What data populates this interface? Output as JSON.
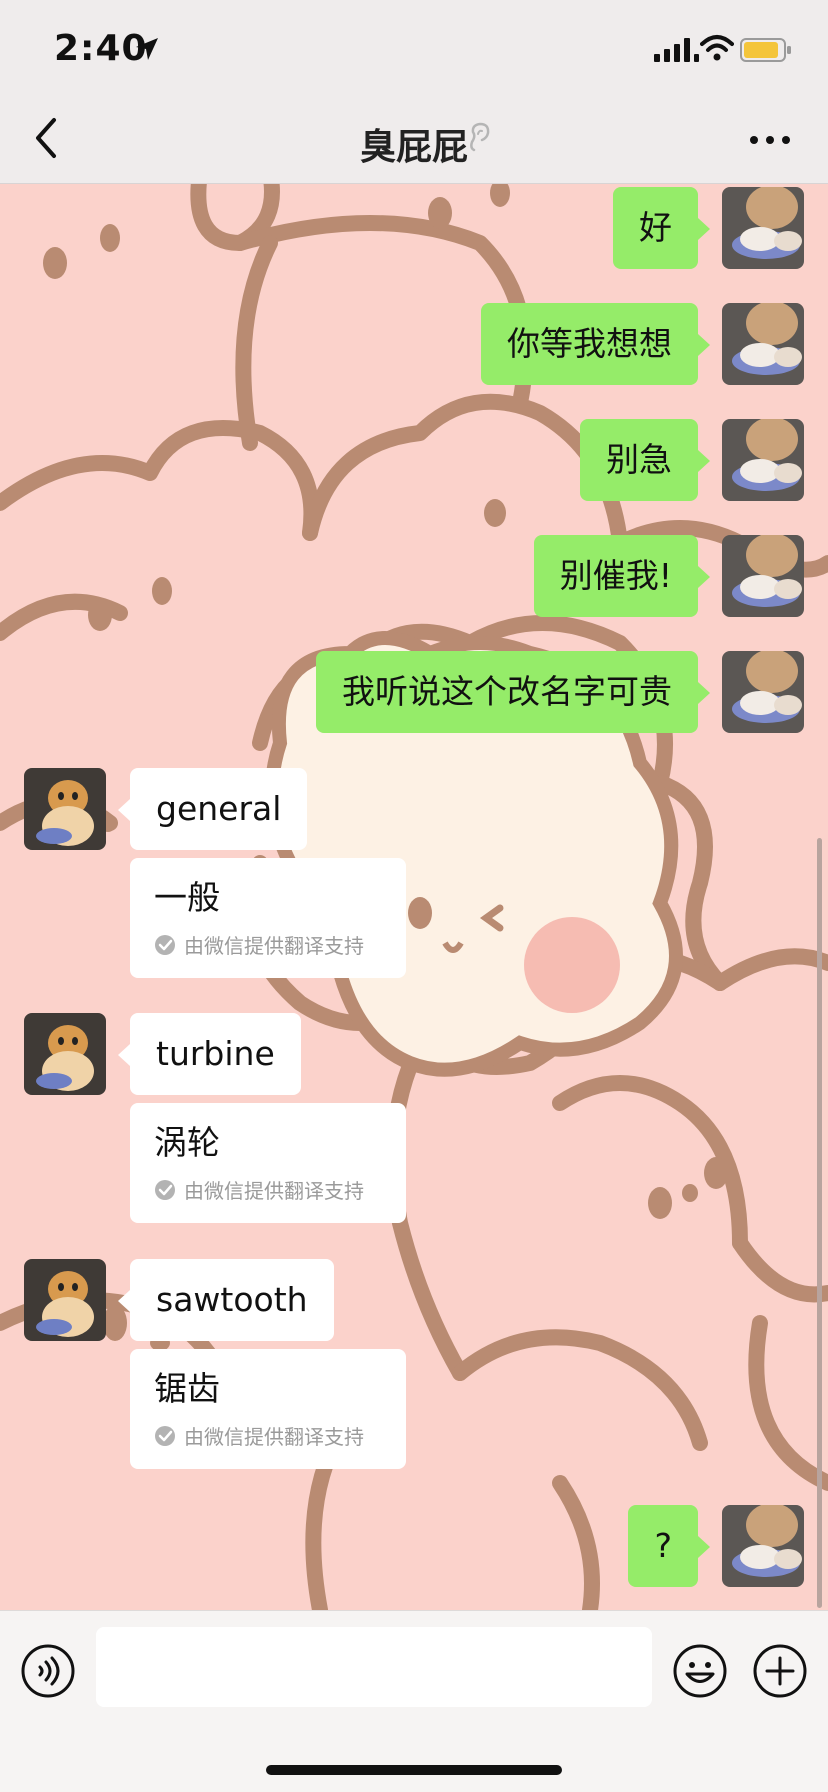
{
  "status": {
    "time": "2:40"
  },
  "nav": {
    "back": "back",
    "title": "臭屁屁",
    "more": "more options"
  },
  "messages": [
    {
      "from": "me",
      "text": "好"
    },
    {
      "from": "me",
      "text": "你等我想想"
    },
    {
      "from": "me",
      "text": "别急"
    },
    {
      "from": "me",
      "text": "别催我!"
    },
    {
      "from": "me",
      "text": "我听说这个改名字可贵"
    },
    {
      "from": "them",
      "text": "general",
      "translation": "一般",
      "note": "由微信提供翻译支持"
    },
    {
      "from": "them",
      "text": "turbine",
      "translation": "涡轮",
      "note": "由微信提供翻译支持"
    },
    {
      "from": "them",
      "text": "sawtooth",
      "translation": "锯齿",
      "note": "由微信提供翻译支持"
    },
    {
      "from": "me",
      "text": "?"
    }
  ],
  "input": {
    "placeholder": ""
  },
  "colors": {
    "my_bubble": "#95ec69",
    "their_bubble": "#ffffff",
    "wallpaper": "#fbd2cb",
    "wallpaper_line": "#b98b72"
  },
  "icons": [
    "location-arrow-icon",
    "signal-icon",
    "wifi-icon",
    "battery-icon",
    "back-chevron-icon",
    "ear-icon",
    "more-dots-icon",
    "voice-icon",
    "emoji-icon",
    "plus-icon",
    "check-icon"
  ]
}
